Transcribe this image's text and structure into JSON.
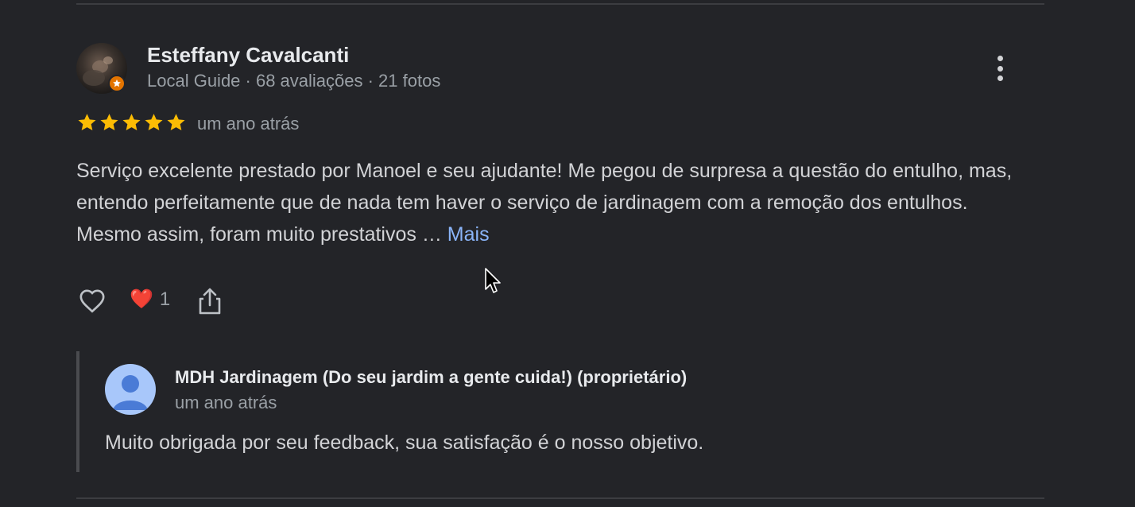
{
  "review": {
    "author_name": "Esteffany Cavalcanti",
    "author_meta": "Local Guide · 68 avaliações · 21 fotos",
    "rating": 5,
    "max_rating": 5,
    "time": "um ano atrás",
    "text": "Serviço excelente prestado por Manoel e seu ajudante! Me pegou de surpresa a questão do entulho, mas, entendo perfeitamente que de nada tem haver o serviço de jardinagem com a remoção dos entulhos. Mesmo assim, foram muito prestativos …",
    "more_label": "Mais",
    "reaction_emoji": "❤️",
    "reaction_count": "1"
  },
  "reply": {
    "author_name": "MDH Jardinagem (Do seu jardim a gente cuida!) (proprietário)",
    "time": "um ano atrás",
    "text": "Muito obrigada por seu feedback, sua satisfação é o nosso objetivo."
  },
  "icons": {
    "more": "more-vert-icon",
    "like": "heart-outline-icon",
    "share": "share-icon",
    "star": "star-icon",
    "badge": "local-guide-badge-icon"
  },
  "colors": {
    "background": "#232428",
    "star": "#fbbc04",
    "link": "#8ab4f8",
    "muted_text": "#9aa0a6",
    "primary_text": "#e8eaed",
    "badge": "#e37400",
    "reply_avatar": "#a8c7fa"
  }
}
